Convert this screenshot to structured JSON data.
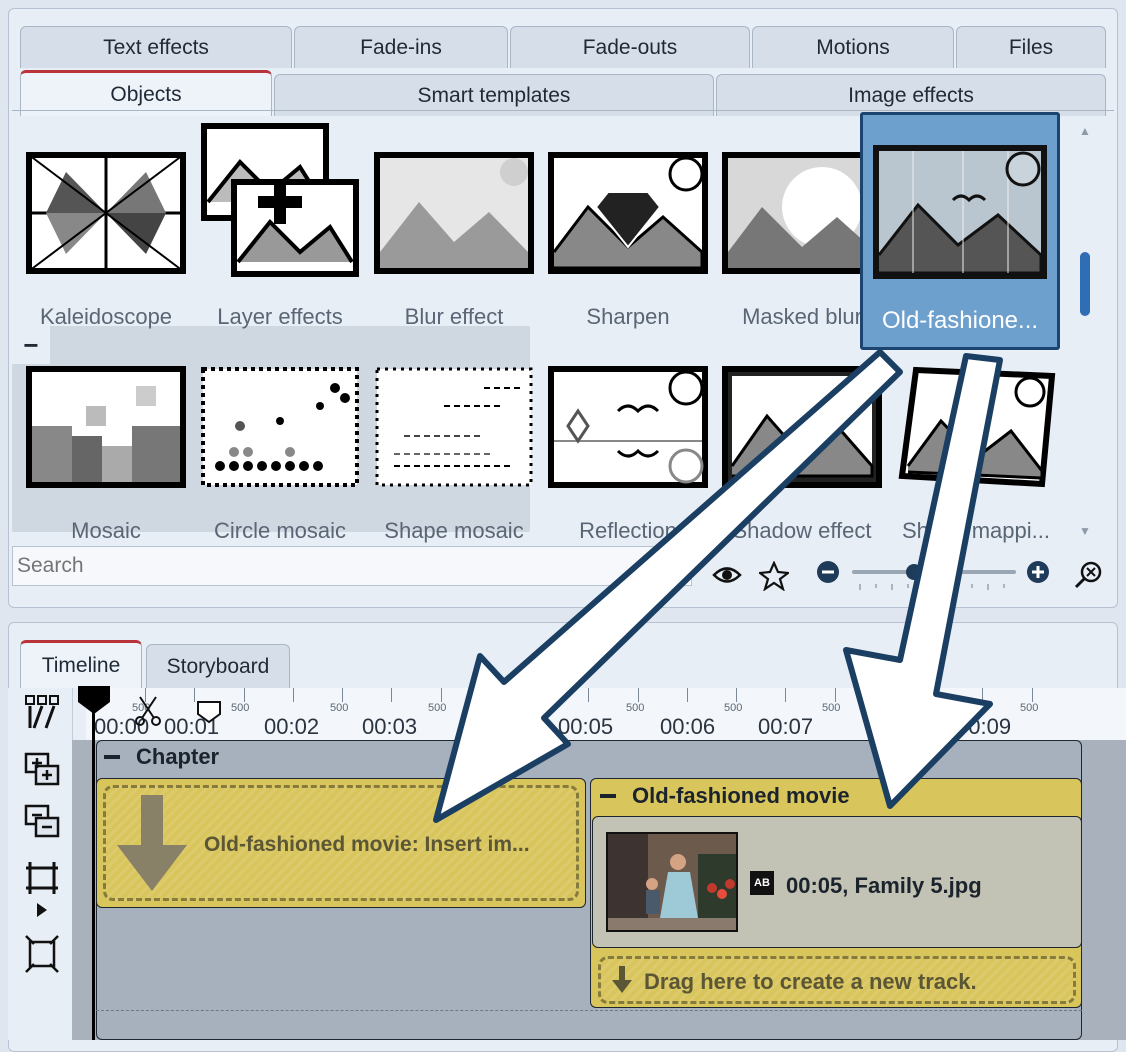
{
  "toolbox": {
    "tabs_row1": [
      "Text effects",
      "Fade-ins",
      "Fade-outs",
      "Motions",
      "Files"
    ],
    "tabs_row2": [
      "Objects",
      "Smart templates",
      "Image effects"
    ],
    "effects": [
      {
        "label": "Kaleidoscope",
        "icon": "kaleidoscope-icon"
      },
      {
        "label": "Layer effects",
        "icon": "layer-effects-icon"
      },
      {
        "label": "Blur effect",
        "icon": "blur-effect-icon"
      },
      {
        "label": "Sharpen",
        "icon": "sharpen-icon"
      },
      {
        "label": "Masked blur",
        "icon": "masked-blur-icon"
      },
      {
        "label": "Old-fashione...",
        "icon": "old-fashioned-icon"
      },
      {
        "label": "Mosaic",
        "icon": "mosaic-icon"
      },
      {
        "label": "Circle mosaic",
        "icon": "circle-mosaic-icon"
      },
      {
        "label": "Shape mosaic",
        "icon": "shape-mosaic-icon"
      },
      {
        "label": "Reflection",
        "icon": "reflection-icon"
      },
      {
        "label": "Shadow effect",
        "icon": "shadow-effect-icon"
      },
      {
        "label": "Shape mappi...",
        "icon": "shape-mapping-icon"
      }
    ],
    "group_collapse_label": "−",
    "search_placeholder": "Search"
  },
  "timeline": {
    "tabs": [
      "Timeline",
      "Storyboard"
    ],
    "ruler": {
      "seconds": [
        "00:00",
        "00:01",
        "00:02",
        "00:03",
        "00:05",
        "00:06",
        "00:07",
        "00:09"
      ],
      "half_marks": [
        "500",
        "500",
        "500",
        "500",
        "500",
        "500",
        "500",
        "500",
        "500"
      ]
    },
    "chapter_title": "Chapter",
    "placeholder_text": "Old-fashioned movie: Insert im...",
    "effect_title": "Old-fashioned movie",
    "image_clip": {
      "badge": "AB",
      "duration": "00:05,",
      "filename": "Family 5.jpg"
    },
    "drag_hint": "Drag here to create a new track."
  },
  "colors": {
    "accent_tab": "#b8343a",
    "selection": "#6da0cc",
    "effect_clip": "#d8c55c",
    "scroll_thumb": "#2f6db5"
  }
}
